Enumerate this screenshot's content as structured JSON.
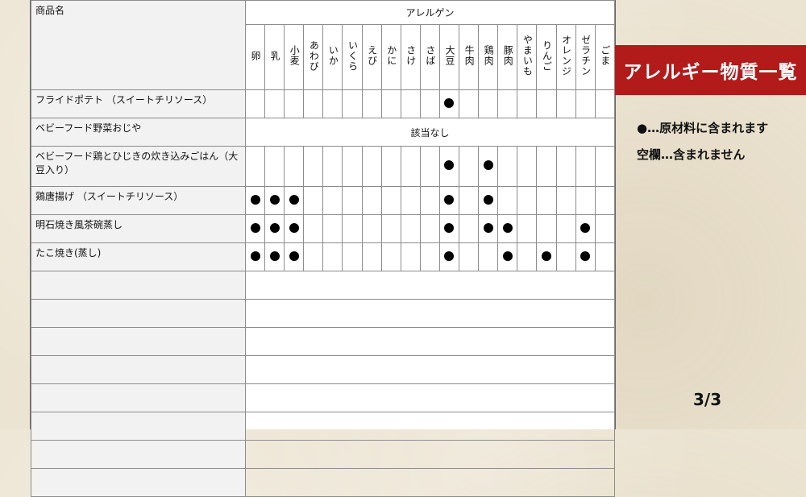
{
  "table": {
    "product_header": "商品名",
    "allergen_header": "アレルゲン",
    "allergens": [
      "卵",
      "乳",
      "小麦",
      "あわび",
      "いか",
      "いくら",
      "えび",
      "かに",
      "さけ",
      "さば",
      "大豆",
      "牛肉",
      "鶏肉",
      "豚肉",
      "やまいも",
      "りんご",
      "オレンジ",
      "ゼラチン",
      "ごま"
    ],
    "rows": [
      {
        "name": "フライドポテト （スイートチリソース）",
        "contains": [
          10
        ]
      },
      {
        "name": "ベビーフード野菜おじや",
        "note": "該当なし"
      },
      {
        "name": "ベビーフード鶏とひじきの炊き込みごはん（大豆入り）",
        "contains": [
          10,
          12
        ]
      },
      {
        "name": "鶏唐揚げ （スイートチリソース）",
        "contains": [
          0,
          1,
          2,
          10,
          12
        ]
      },
      {
        "name": "明石焼き風茶碗蒸し",
        "contains": [
          0,
          1,
          2,
          10,
          12,
          13,
          17
        ]
      },
      {
        "name": "たこ焼き(蒸し)",
        "contains": [
          0,
          1,
          2,
          10,
          13,
          15,
          17
        ]
      }
    ],
    "empty_rows": 8
  },
  "sidebar": {
    "title": "アレルギー物質一覧",
    "legend_contains": "●…原材料に含まれます",
    "legend_blank": "空欄…含まれません"
  },
  "page_indicator": "3/3",
  "colors": {
    "banner": "#b31b1b",
    "name_bg": "#f2f2f2"
  }
}
